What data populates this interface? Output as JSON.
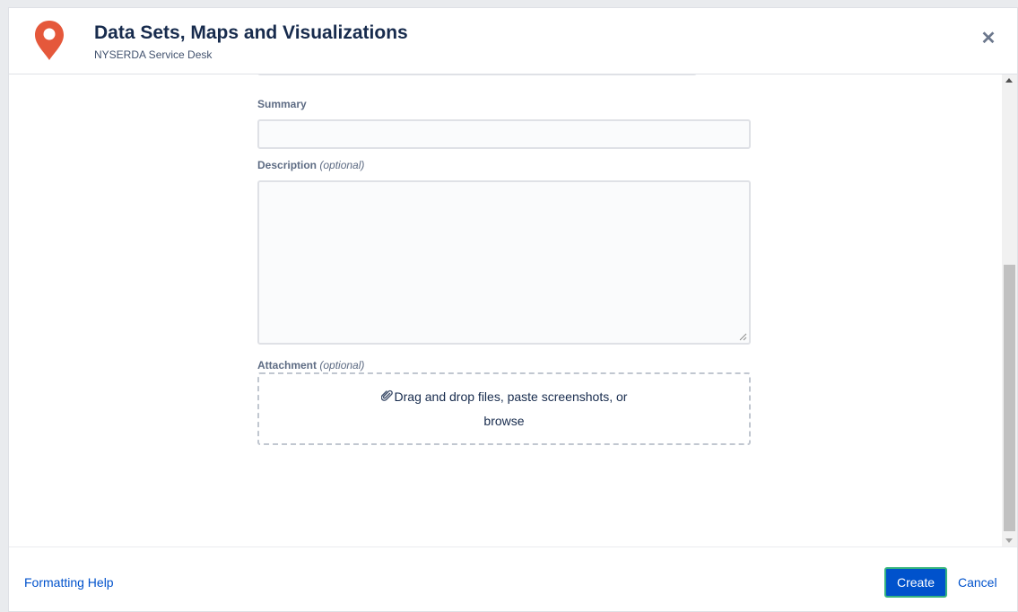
{
  "header": {
    "title": "Data Sets, Maps and Visualizations",
    "subtitle": "NYSERDA Service Desk",
    "logo_icon": "map-pin-icon",
    "close_icon": "close-icon",
    "close_glyph": "✕"
  },
  "form": {
    "summary": {
      "label": "Summary",
      "value": ""
    },
    "description": {
      "label": "Description",
      "optional": "(optional)",
      "value": ""
    },
    "attachment": {
      "label": "Attachment",
      "optional": "(optional)",
      "drop_text": "Drag and drop files, paste screenshots, or",
      "browse_label": "browse",
      "icon": "paperclip-icon"
    }
  },
  "footer": {
    "help_label": "Formatting Help",
    "create_label": "Create",
    "cancel_label": "Cancel"
  },
  "colors": {
    "brand": "#e5583b",
    "primary": "#0052cc",
    "focus_ring": "#36b37e"
  }
}
